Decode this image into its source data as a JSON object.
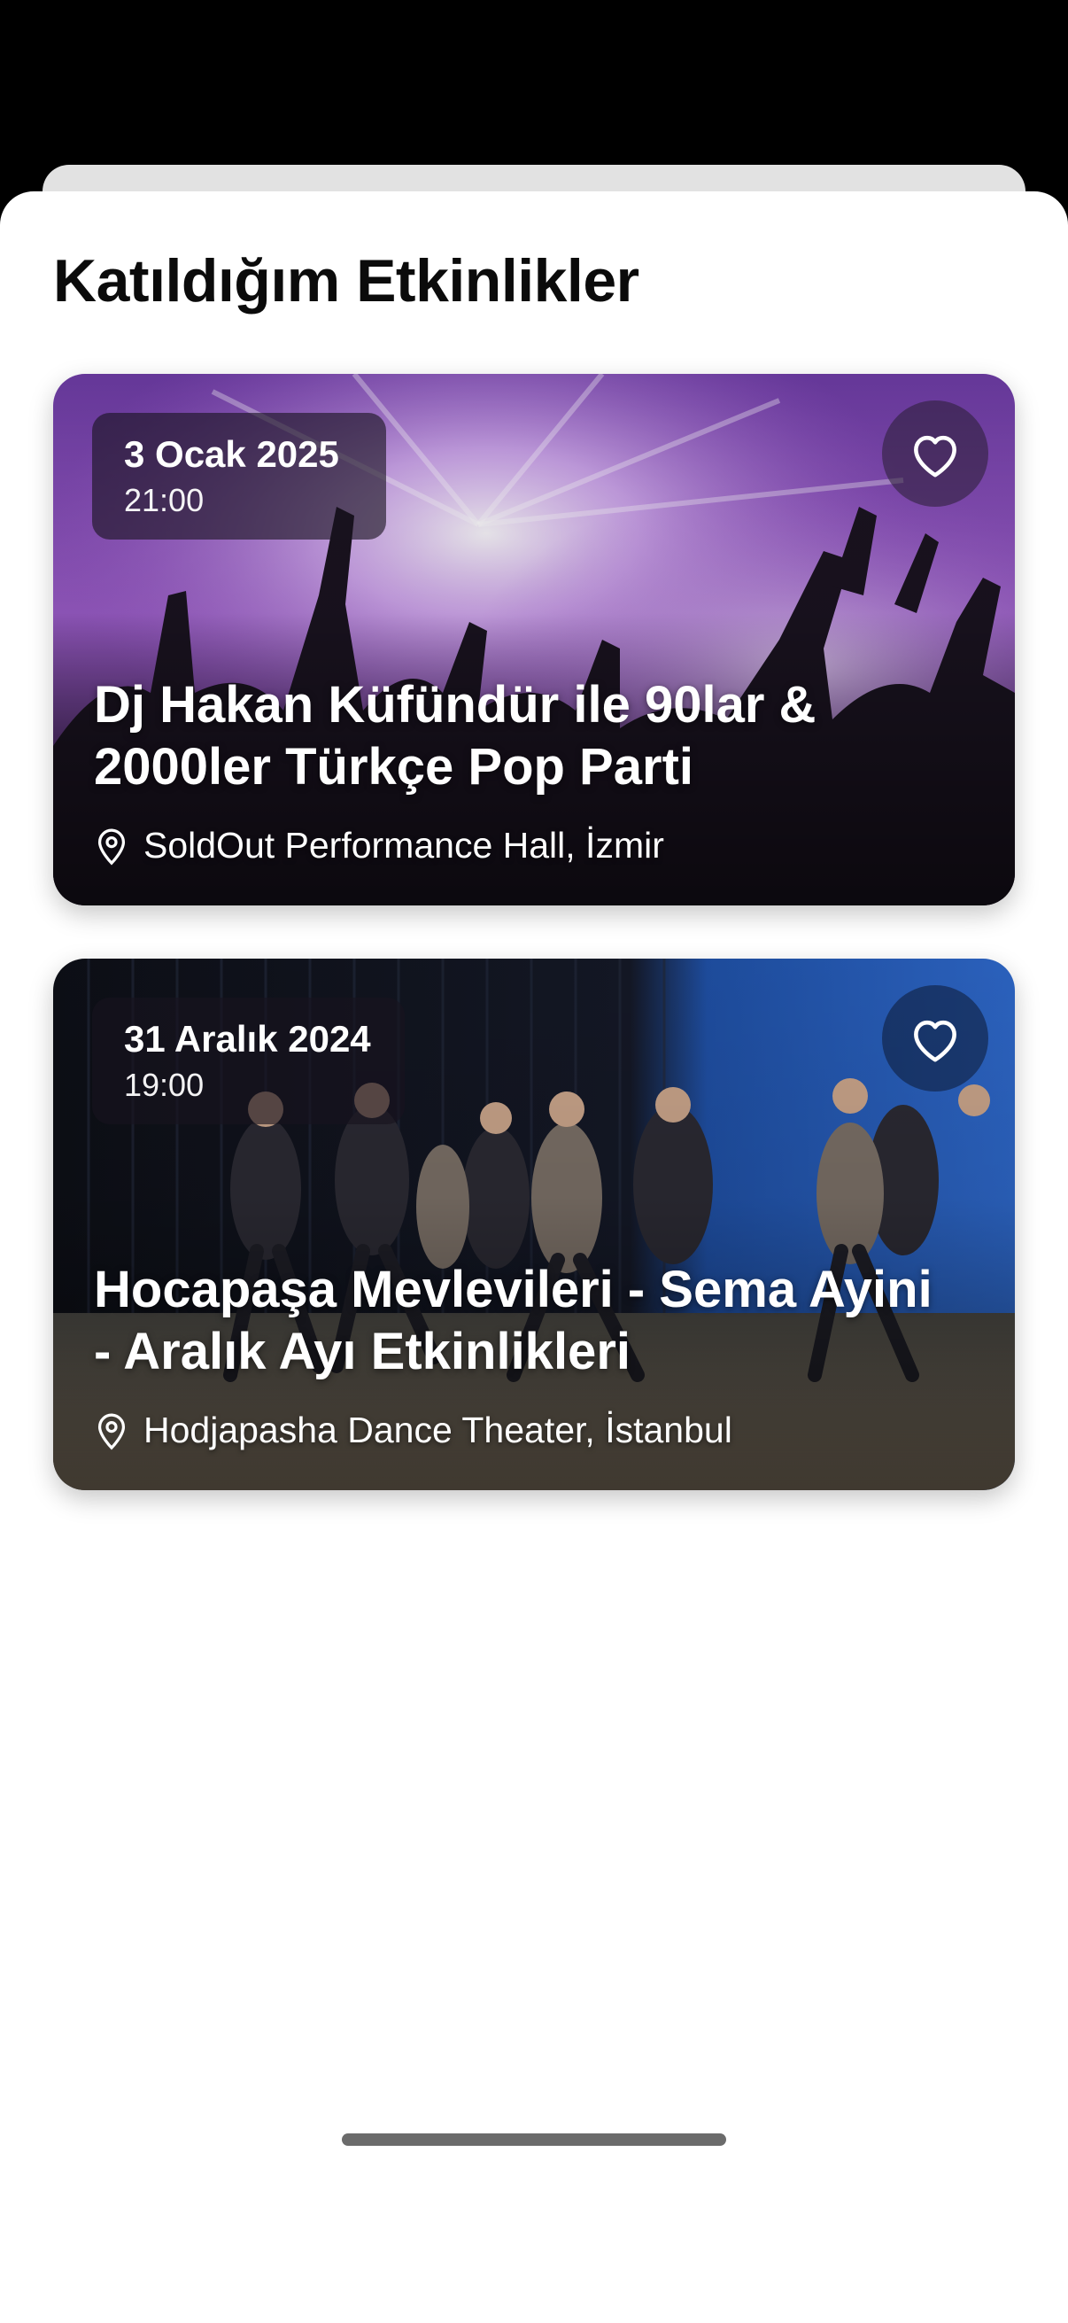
{
  "page_title": "Katıldığım Etkinlikler",
  "events": [
    {
      "date": "3 Ocak 2025",
      "time": "21:00",
      "title": "Dj Hakan Küfündür ile 90lar & 2000ler Türkçe Pop Parti",
      "location": "SoldOut Performance Hall, İzmir",
      "favorite_icon": "heart-outline-icon",
      "location_icon": "map-pin-icon"
    },
    {
      "date": "31 Aralık 2024",
      "time": "19:00",
      "title": "Hocapaşa Mevlevileri - Sema Ayini - Aralık Ayı Etkinlikleri",
      "location": "Hodjapasha Dance Theater, İstanbul",
      "favorite_icon": "heart-outline-icon",
      "location_icon": "map-pin-icon"
    }
  ],
  "colors": {
    "sheet_background": "#ffffff",
    "title_text": "#0b0b0b",
    "card_text": "#ffffff"
  }
}
